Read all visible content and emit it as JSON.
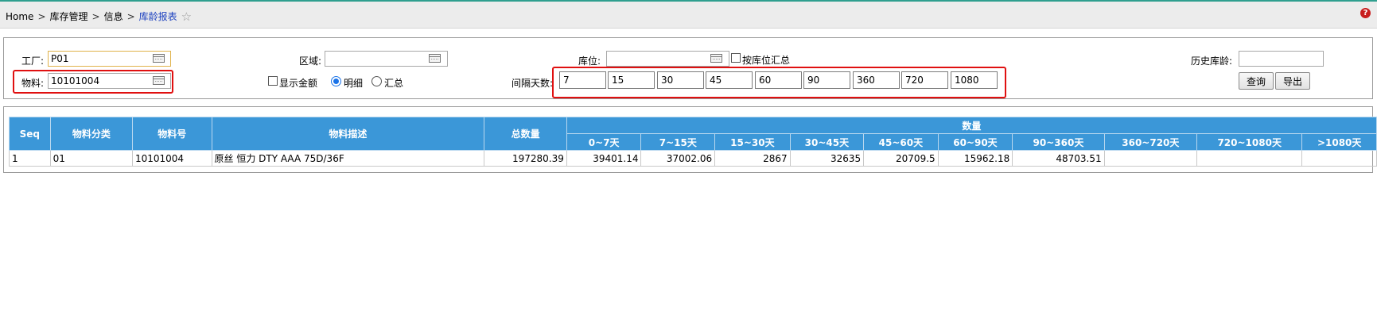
{
  "breadcrumb": {
    "items": [
      "Home",
      "库存管理",
      "信息"
    ],
    "separator": ">",
    "current": "库龄报表"
  },
  "filters": {
    "plant_label": "工厂:",
    "plant_value": "P01",
    "area_label": "区域:",
    "area_value": "",
    "location_label": "库位:",
    "location_value": "",
    "by_location_label": "按库位汇总",
    "history_label": "历史库龄:",
    "history_value": "",
    "material_label": "物料:",
    "material_value": "10101004",
    "show_amount_label": "显示金额",
    "detail_label": "明细",
    "summary_label": "汇总",
    "interval_label": "间隔天数:",
    "intervals": [
      "7",
      "15",
      "30",
      "45",
      "60",
      "90",
      "360",
      "720",
      "1080"
    ],
    "query_button": "查询",
    "export_button": "导出"
  },
  "table": {
    "headers": {
      "seq": "Seq",
      "category": "物料分类",
      "material": "物料号",
      "description": "物料描述",
      "total": "总数量",
      "group": "数量"
    },
    "buckets": [
      "0~7天",
      "7~15天",
      "15~30天",
      "30~45天",
      "45~60天",
      "60~90天",
      "90~360天",
      "360~720天",
      "720~1080天",
      ">1080天"
    ],
    "rows": [
      {
        "seq": "1",
        "category": "01",
        "material": "10101004",
        "description": "原丝 恒力 DTY AAA 75D/36F",
        "total": "197280.39",
        "buckets": [
          "39401.14",
          "37002.06",
          "2867",
          "32635",
          "20709.5",
          "15962.18",
          "48703.51",
          "",
          "",
          ""
        ]
      }
    ]
  },
  "colors": {
    "header_bg": "#3b97d8",
    "highlight": "#e01010",
    "breadcrumb_current": "#1a3fbf"
  }
}
